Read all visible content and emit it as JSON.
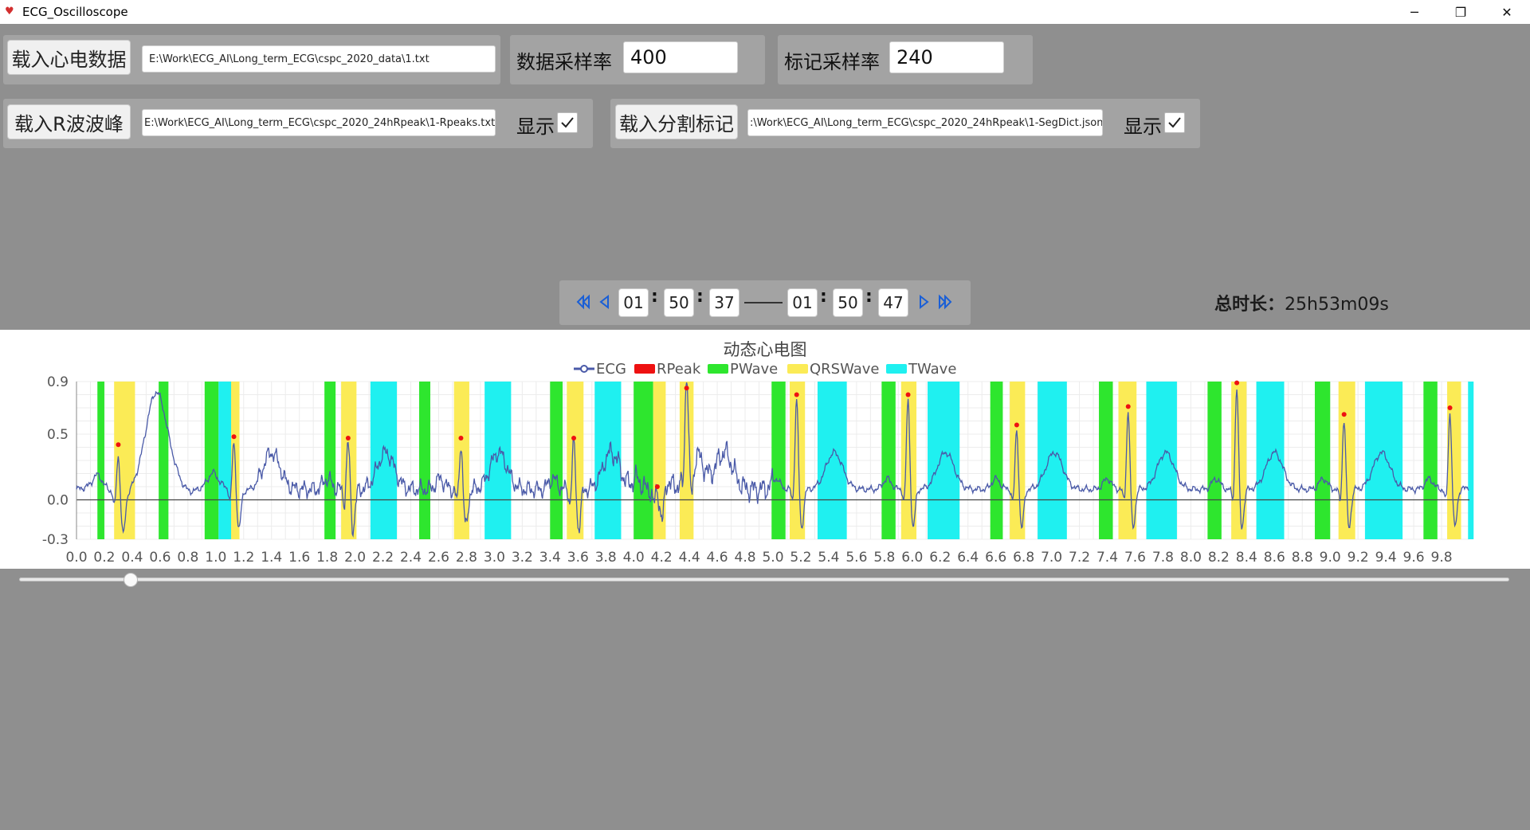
{
  "window": {
    "title": "ECG_Oscilloscope",
    "icon": "heart-icon"
  },
  "row1": {
    "load_ecg_label": "载入心电数据",
    "ecg_path": "E:\\Work\\ECG_AI\\Long_term_ECG\\cspc_2020_data\\1.txt",
    "data_rate_label": "数据采样率",
    "data_rate_value": "400",
    "mark_rate_label": "标记采样率",
    "mark_rate_value": "240"
  },
  "row2": {
    "load_rpeak_label": "载入R波波峰",
    "rpeak_path": "E:\\Work\\ECG_AI\\Long_term_ECG\\cspc_2020_24hRpeak\\1-Rpeaks.txt",
    "show_label_1": "显示",
    "show_1_checked": true,
    "load_seg_label": "载入分割标记",
    "seg_path": ":\\Work\\ECG_AI\\Long_term_ECG\\cspc_2020_24hRpeak\\1-SegDict.json",
    "show_label_2": "显示",
    "show_2_checked": true
  },
  "nav": {
    "start_h": "01",
    "start_m": "50",
    "start_s": "37",
    "end_h": "01",
    "end_m": "50",
    "end_s": "47",
    "colon": ":",
    "icons": [
      "skip-back-icon",
      "step-back-icon",
      "step-forward-icon",
      "skip-forward-icon"
    ]
  },
  "total": {
    "label": "总时长：",
    "value": "25h53m09s"
  },
  "slider": {
    "position": 0.075
  },
  "chart_data": {
    "type": "line",
    "title": "动态心电图",
    "legend": [
      "ECG",
      "RPeak",
      "PWave",
      "QRSWave",
      "TWave"
    ],
    "legend_placement": "top-center",
    "colors": {
      "ECG": "#4a5aa8",
      "RPeak": "#ee1111",
      "PWave": "#2ee62e",
      "QRSWave": "#fbeb56",
      "TWave": "#1ff0f0"
    },
    "xlim": [
      0,
      10
    ],
    "ylim": [
      -0.3,
      0.9
    ],
    "x_ticks": [
      "0.0",
      "0.2",
      "0.4",
      "0.6",
      "0.8",
      "1.0",
      "1.2",
      "1.4",
      "1.6",
      "1.8",
      "2.0",
      "2.2",
      "2.4",
      "2.6",
      "2.8",
      "3.0",
      "3.2",
      "3.4",
      "3.6",
      "3.8",
      "4.0",
      "4.2",
      "4.4",
      "4.6",
      "4.8",
      "5.0",
      "5.2",
      "5.4",
      "5.6",
      "5.8",
      "6.0",
      "6.2",
      "6.4",
      "6.6",
      "6.8",
      "7.0",
      "7.2",
      "7.4",
      "7.6",
      "7.8",
      "8.0",
      "8.2",
      "8.4",
      "8.6",
      "8.8",
      "9.0",
      "9.2",
      "9.4",
      "9.6",
      "9.8"
    ],
    "y_ticks": [
      "0.9",
      "0.5",
      "0.0",
      "-0.3"
    ],
    "grid": true,
    "rpeaks": [
      {
        "x": 0.3,
        "y": 0.42
      },
      {
        "x": 1.13,
        "y": 0.48
      },
      {
        "x": 1.95,
        "y": 0.47
      },
      {
        "x": 2.76,
        "y": 0.47
      },
      {
        "x": 3.57,
        "y": 0.47
      },
      {
        "x": 4.17,
        "y": 0.1
      },
      {
        "x": 4.38,
        "y": 0.85
      },
      {
        "x": 5.17,
        "y": 0.8
      },
      {
        "x": 5.97,
        "y": 0.8
      },
      {
        "x": 6.75,
        "y": 0.57
      },
      {
        "x": 7.55,
        "y": 0.71
      },
      {
        "x": 8.33,
        "y": 0.89
      },
      {
        "x": 9.1,
        "y": 0.65
      },
      {
        "x": 9.86,
        "y": 0.7
      }
    ],
    "pwave": [
      [
        0.15,
        0.2
      ],
      [
        0.59,
        0.66
      ],
      [
        0.92,
        1.02
      ],
      [
        1.78,
        1.86
      ],
      [
        2.46,
        2.54
      ],
      [
        3.4,
        3.49
      ],
      [
        4.0,
        4.14
      ],
      [
        4.99,
        5.09
      ],
      [
        5.78,
        5.88
      ],
      [
        6.56,
        6.65
      ],
      [
        7.34,
        7.44
      ],
      [
        8.12,
        8.22
      ],
      [
        8.89,
        9.0
      ],
      [
        9.67,
        9.77
      ]
    ],
    "qrswave": [
      [
        0.27,
        0.42
      ],
      [
        1.11,
        1.17
      ],
      [
        1.9,
        2.01
      ],
      [
        2.71,
        2.82
      ],
      [
        3.52,
        3.64
      ],
      [
        4.14,
        4.23
      ],
      [
        4.33,
        4.43
      ],
      [
        5.12,
        5.23
      ],
      [
        5.92,
        6.03
      ],
      [
        6.7,
        6.81
      ],
      [
        7.48,
        7.61
      ],
      [
        8.29,
        8.4
      ],
      [
        9.06,
        9.18
      ],
      [
        9.84,
        9.94
      ]
    ],
    "twave": [
      [
        1.02,
        1.11
      ],
      [
        2.11,
        2.3
      ],
      [
        2.93,
        3.12
      ],
      [
        3.72,
        3.91
      ],
      [
        5.32,
        5.53
      ],
      [
        6.11,
        6.34
      ],
      [
        6.9,
        7.11
      ],
      [
        7.68,
        7.9
      ],
      [
        8.47,
        8.67
      ],
      [
        9.25,
        9.52
      ],
      [
        9.99,
        10.03
      ]
    ]
  }
}
